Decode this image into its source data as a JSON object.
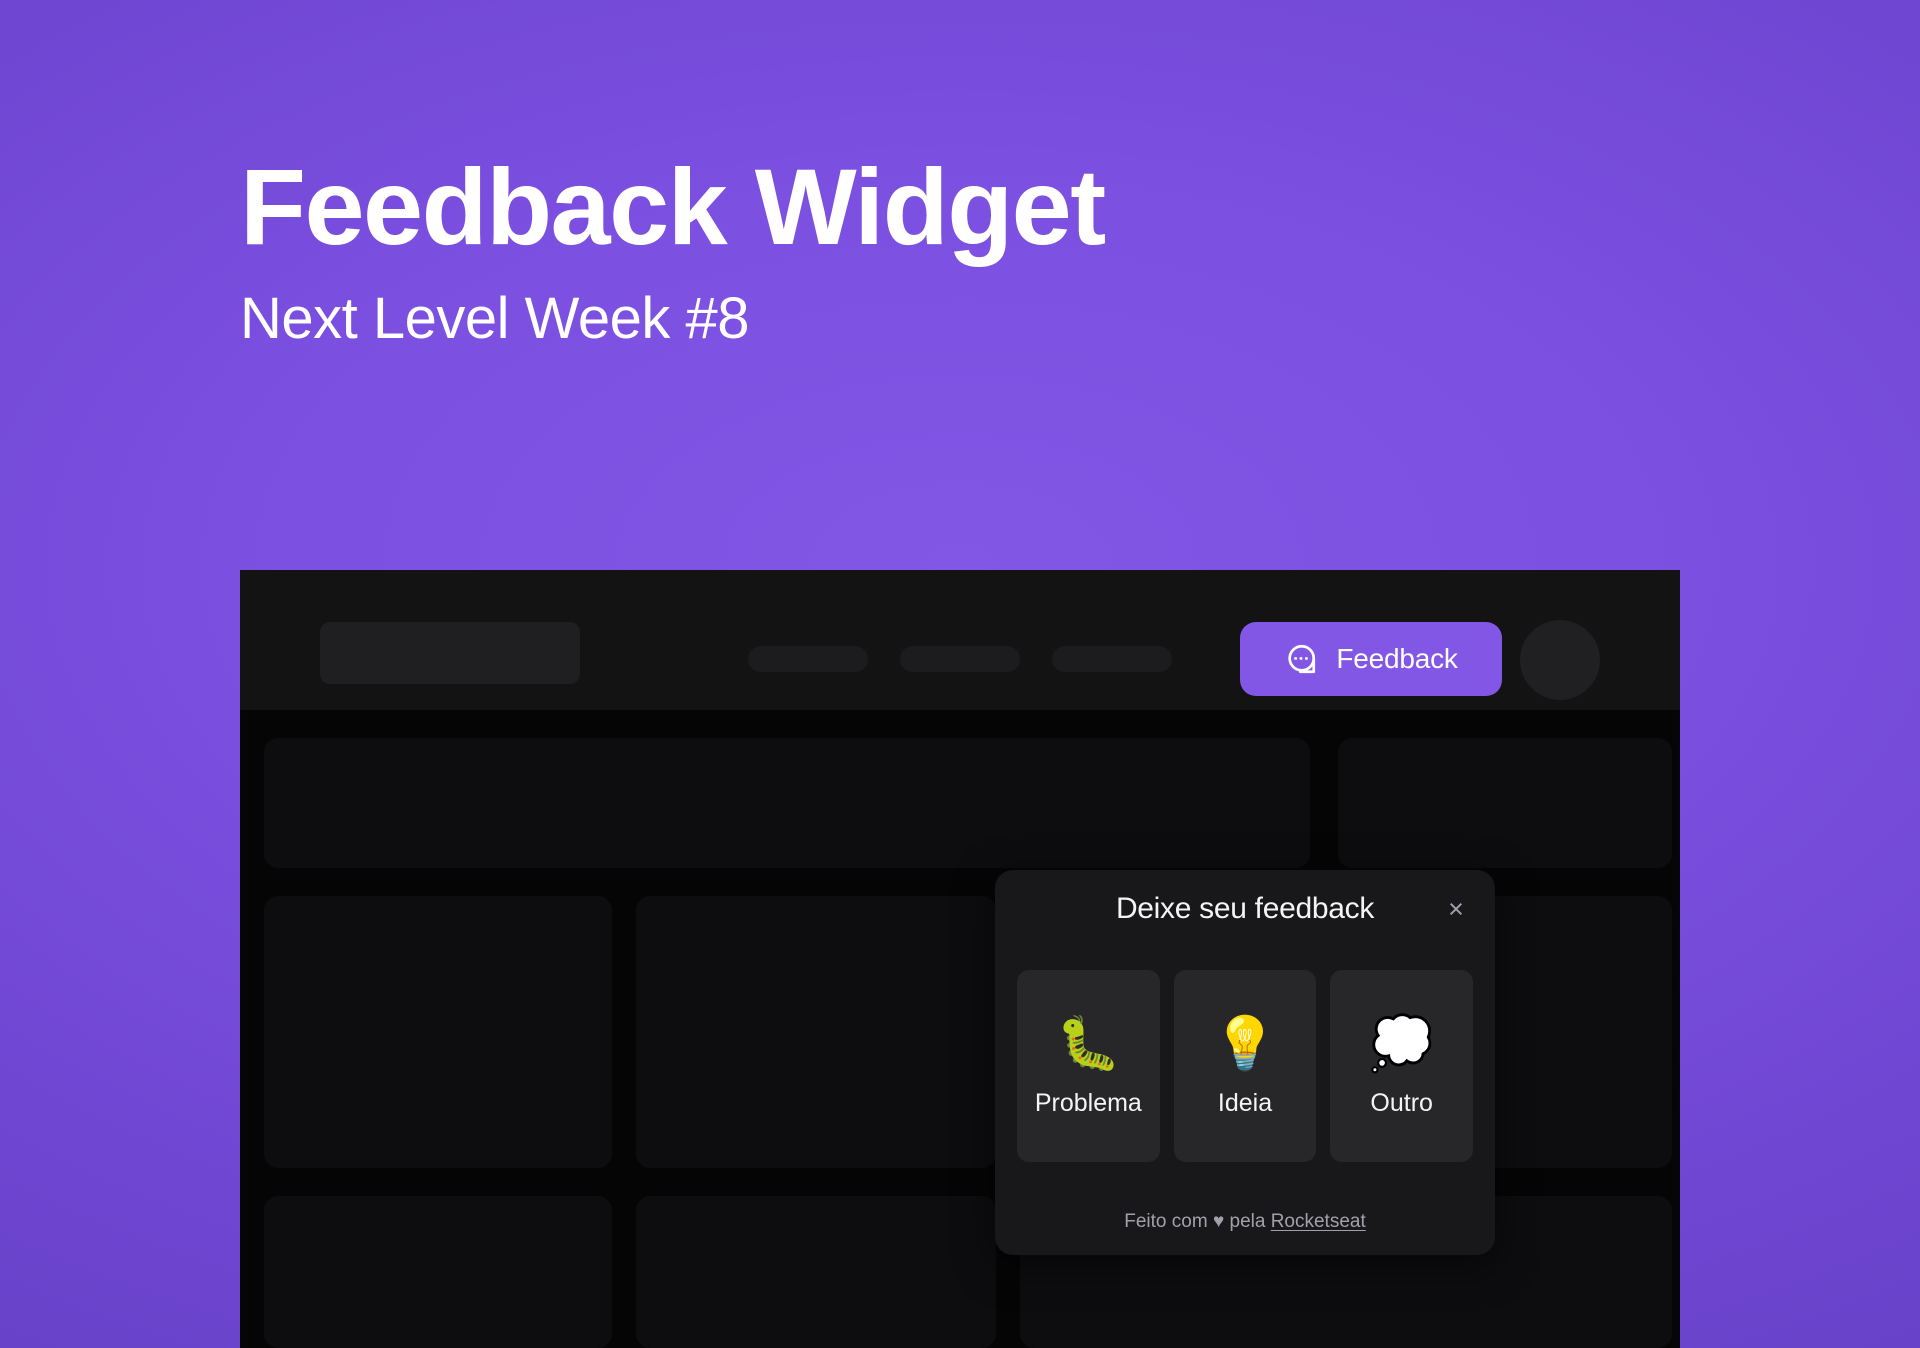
{
  "hero": {
    "title": "Feedback Widget",
    "subtitle": "Next Level Week #8"
  },
  "colors": {
    "background_start": "#8257E5",
    "background_end": "#6138BE",
    "accent": "#8257E5",
    "mockup_navbar": "#131313",
    "mockup_body": "#050505",
    "popup_bg": "#18181A",
    "option_card_bg": "#27272A",
    "muted_text": "#A1A1AA"
  },
  "mockup": {
    "navbar": {
      "feedback_button": {
        "label": "Feedback",
        "icon": "chat-bubble-dots-icon"
      },
      "avatar_placeholder": "",
      "skeleton_items": [
        "logo-placeholder",
        "nav-link-1",
        "nav-link-2",
        "nav-link-3"
      ]
    },
    "content_blocks": [
      "block-wide",
      "block-top-right",
      "block-mid-left",
      "block-mid-center",
      "block-mid-right",
      "block-bottom-left",
      "block-bottom-center",
      "block-bottom-right"
    ]
  },
  "popup": {
    "title": "Deixe seu feedback",
    "close_label": "×",
    "options": [
      {
        "label": "Problema",
        "emoji": "🐛",
        "icon": "bug-emoji"
      },
      {
        "label": "Ideia",
        "emoji": "💡",
        "icon": "light-bulb-emoji"
      },
      {
        "label": "Outro",
        "emoji": "💭",
        "icon": "thought-balloon-emoji"
      }
    ],
    "footer": {
      "prefix": "Feito com ",
      "heart": "♥",
      "middle": " pela ",
      "brand": "Rocketseat"
    }
  }
}
